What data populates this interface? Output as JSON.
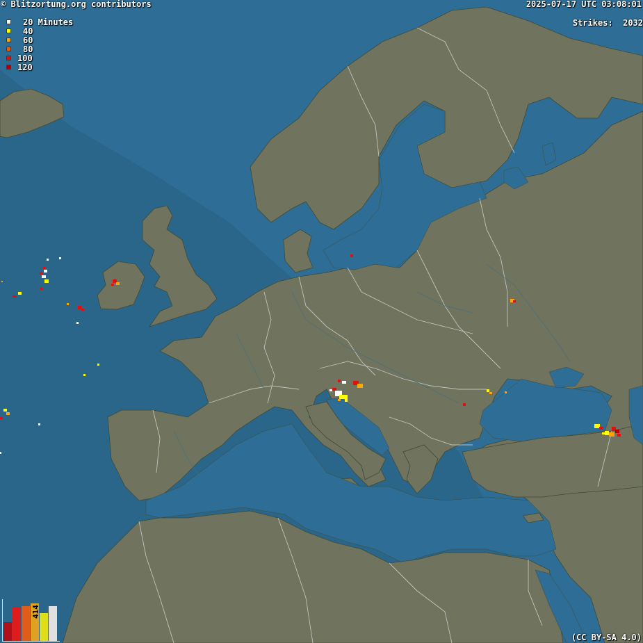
{
  "header": {
    "copyright": "© Blitzortung.org contributors",
    "timestamp": "2025-07-17 UTC 03:08:01"
  },
  "strikes": {
    "label": "Strikes:",
    "count": "2032"
  },
  "legend": {
    "items": [
      {
        "label": "20 Minutes",
        "color": "#ffffff"
      },
      {
        "label": "40",
        "color": "#ffff00"
      },
      {
        "label": "60",
        "color": "#ffa500"
      },
      {
        "label": "80",
        "color": "#e06010"
      },
      {
        "label": "100",
        "color": "#e01010"
      },
      {
        "label": "120",
        "color": "#b00000"
      }
    ]
  },
  "histogram": {
    "label": "414",
    "bars": [
      {
        "value": 0.48,
        "color": "#b0101a"
      },
      {
        "value": 0.88,
        "color": "#dd1c1c"
      },
      {
        "value": 0.9,
        "color": "#e05c1a"
      },
      {
        "value": 0.96,
        "color": "#e0a020"
      },
      {
        "value": 0.72,
        "color": "#dede1c"
      },
      {
        "value": 0.9,
        "color": "#e0e0e0"
      }
    ]
  },
  "license": "(CC BY-SA 4.0)",
  "colors": {
    "sea": "#2e6e96",
    "land": "#70735e",
    "border": "#cfd2cc"
  },
  "strike_clusters": [
    {
      "name": "north-atlantic-west",
      "colors": [
        "#ffffff",
        "#ffff00",
        "#e01010"
      ]
    },
    {
      "name": "ireland",
      "colors": [
        "#e01010",
        "#ffa500"
      ]
    },
    {
      "name": "slovenia-croatia",
      "colors": [
        "#ffffff",
        "#ffff00",
        "#ffa500",
        "#e01010"
      ]
    },
    {
      "name": "romania-coast",
      "colors": [
        "#ffa500",
        "#ffff00"
      ]
    },
    {
      "name": "georgia",
      "colors": [
        "#ffff00",
        "#e01010",
        "#ffa500"
      ]
    },
    {
      "name": "russia-central",
      "colors": [
        "#ffa500",
        "#e01010"
      ]
    }
  ]
}
